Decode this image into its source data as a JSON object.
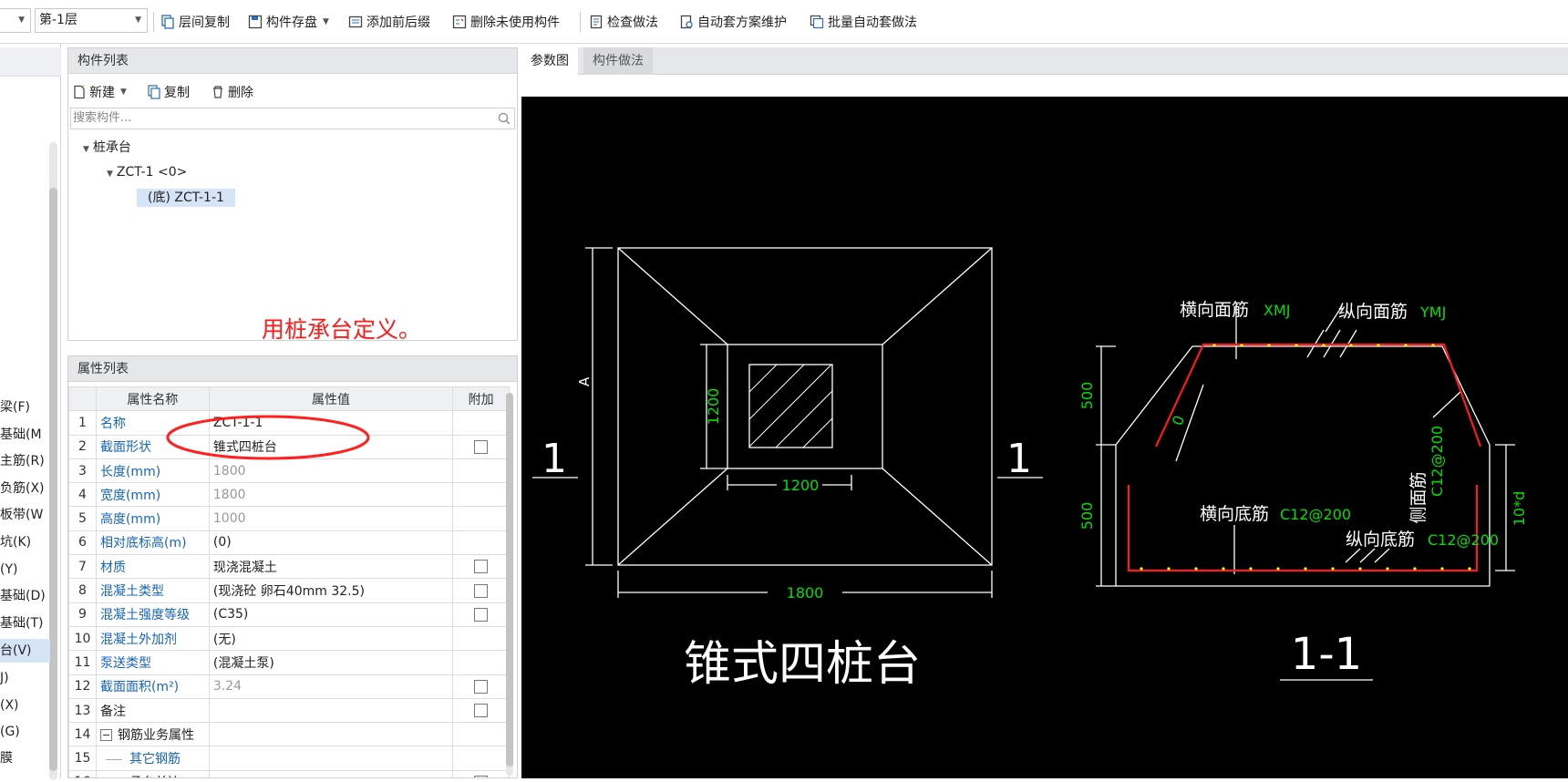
{
  "toolbar": {
    "combo1": "",
    "floor": "第-1层",
    "buttons": [
      "层间复制",
      "构件存盘",
      "添加前后缀",
      "删除未使用构件",
      "检查做法",
      "自动套方案维护",
      "批量自动套做法"
    ]
  },
  "leftnav": {
    "items": [
      {
        "label": "梁(F)"
      },
      {
        "label": "基础(M"
      },
      {
        "label": "主筋(R)"
      },
      {
        "label": "负筋(X)"
      },
      {
        "label": "板带(W"
      },
      {
        "label": "坑(K)"
      },
      {
        "label": "(Y)"
      },
      {
        "label": "基础(D)"
      },
      {
        "label": "基础(T)"
      },
      {
        "label": "台(V)",
        "selected": true
      },
      {
        "label": "J)"
      },
      {
        "label": "(X)"
      },
      {
        "label": "(G)"
      },
      {
        "label": "膜"
      }
    ]
  },
  "complist": {
    "title": "构件列表",
    "new": "新建",
    "copy": "复制",
    "delete": "删除",
    "search_placeholder": "搜索构件...",
    "tree": {
      "root": "桩承台",
      "child": "ZCT-1 <0>",
      "leaf": "(底) ZCT-1-1"
    }
  },
  "annotation": "用桩承台定义。",
  "proplist": {
    "title": "属性列表",
    "headers": [
      "属性名称",
      "属性值",
      "附加"
    ],
    "rows": [
      {
        "no": "1",
        "name": "名称",
        "value": "ZCT-1-1",
        "checkbox": false,
        "gray": false,
        "blue": true
      },
      {
        "no": "2",
        "name": "截面形状",
        "value": "锥式四桩台",
        "checkbox": true,
        "gray": false,
        "blue": true
      },
      {
        "no": "3",
        "name": "长度(mm)",
        "value": "1800",
        "checkbox": false,
        "gray": true,
        "blue": true
      },
      {
        "no": "4",
        "name": "宽度(mm)",
        "value": "1800",
        "checkbox": false,
        "gray": true,
        "blue": true
      },
      {
        "no": "5",
        "name": "高度(mm)",
        "value": "1000",
        "checkbox": false,
        "gray": true,
        "blue": true
      },
      {
        "no": "6",
        "name": "相对底标高(m)",
        "value": "(0)",
        "checkbox": false,
        "gray": false,
        "blue": true
      },
      {
        "no": "7",
        "name": "材质",
        "value": "现浇混凝土",
        "checkbox": true,
        "gray": false,
        "blue": true
      },
      {
        "no": "8",
        "name": "混凝土类型",
        "value": "(现浇砼 卵石40mm 32.5)",
        "checkbox": true,
        "gray": false,
        "blue": true
      },
      {
        "no": "9",
        "name": "混凝土强度等级",
        "value": "(C35)",
        "checkbox": true,
        "gray": false,
        "blue": true
      },
      {
        "no": "10",
        "name": "混凝土外加剂",
        "value": "(无)",
        "checkbox": false,
        "gray": false,
        "blue": true
      },
      {
        "no": "11",
        "name": "泵送类型",
        "value": "(混凝土泵)",
        "checkbox": false,
        "gray": false,
        "blue": true
      },
      {
        "no": "12",
        "name": "截面面积(m²)",
        "value": "3.24",
        "checkbox": true,
        "gray": true,
        "blue": true
      },
      {
        "no": "13",
        "name": "备注",
        "value": "",
        "checkbox": true,
        "gray": false,
        "blue": false
      },
      {
        "no": "14",
        "name": "钢筋业务属性",
        "value": "",
        "checkbox": false,
        "gray": false,
        "blue": false,
        "group": true
      },
      {
        "no": "15",
        "name": "其它钢筋",
        "value": "",
        "checkbox": false,
        "gray": false,
        "blue": true,
        "indent": true
      },
      {
        "no": "16",
        "name": "承台单边",
        "value": "",
        "checkbox": true,
        "gray": false,
        "blue": false,
        "indent": true
      }
    ]
  },
  "tabs": [
    "参数图",
    "构件做法"
  ],
  "cad": {
    "plan_title": "锥式四桩台",
    "section_title": "1-1",
    "section_mark": "1",
    "dim_A": "A",
    "dim_1200v": "1200",
    "dim_1200h": "1200",
    "dim_1800": "1800",
    "dim_500a": "500",
    "dim_500b": "500",
    "dim_10d": "10*d",
    "label_top_h": "横向面筋",
    "label_top_h_code": "XMJ",
    "label_top_v": "纵向面筋",
    "label_top_v_code": "YMJ",
    "label_side": "侧面筋",
    "label_side_code": "C12@200",
    "label_bot_h": "横向底筋",
    "label_bot_h_code": "C12@200",
    "label_bot_v": "纵向底筋",
    "label_bot_v_code": "C12@200",
    "label_zero": "0",
    "colors": {
      "line": "#ffffff",
      "dim": "#00e000",
      "rebar": "#ff1a1a",
      "dot": "#ffff00"
    }
  }
}
